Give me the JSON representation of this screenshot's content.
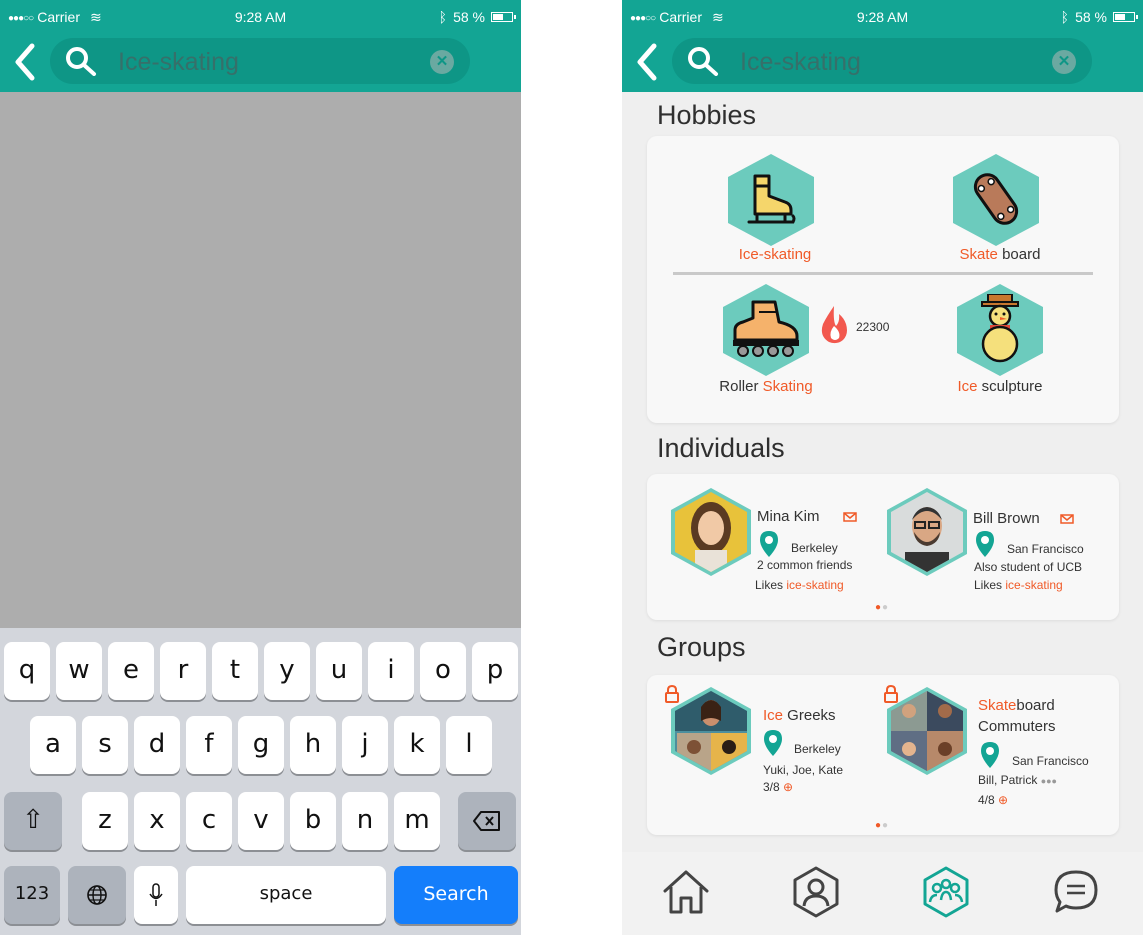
{
  "status": {
    "carrier": "Carrier",
    "time": "9:28 AM",
    "battery": "58 %"
  },
  "search": {
    "query": "Ice-skating"
  },
  "keyboard": {
    "row1": [
      "q",
      "w",
      "e",
      "r",
      "t",
      "y",
      "u",
      "i",
      "o",
      "p"
    ],
    "row2": [
      "a",
      "s",
      "d",
      "f",
      "g",
      "h",
      "j",
      "k",
      "l"
    ],
    "row3": [
      "z",
      "x",
      "c",
      "v",
      "b",
      "n",
      "m"
    ],
    "numbers_label": "123",
    "space_label": "space",
    "search_label": "Search"
  },
  "results": {
    "hobbies_title": "Hobbies",
    "hobbies": [
      {
        "match": "Ice-skating",
        "rest": ""
      },
      {
        "match": "Skate",
        "rest": " board"
      },
      {
        "prefix": "Roller ",
        "match": "Skating"
      },
      {
        "match": "Ice",
        "rest": " sculpture"
      }
    ],
    "trending_count": "22300",
    "individuals_title": "Individuals",
    "individuals": [
      {
        "name": "Mina Kim",
        "location": "Berkeley",
        "detail": "2 common friends",
        "likes_prefix": "Likes ",
        "likes": "ice-skating"
      },
      {
        "name": "Bill Brown",
        "location": "San Francisco",
        "detail": "Also student of UCB",
        "likes_prefix": "Likes ",
        "likes": "ice-skating"
      }
    ],
    "groups_title": "Groups",
    "groups": [
      {
        "name_match": "Ice",
        "name_rest": " Greeks",
        "location": "Berkeley",
        "members": "Yuki, Joe, Kate",
        "capacity": "3/8"
      },
      {
        "name_match": "Skate",
        "name_rest": "board",
        "name_line2": "Commuters",
        "location": "San Francisco",
        "members": "Bill, Patrick",
        "capacity": "4/8"
      }
    ]
  },
  "colors": {
    "teal": "#13a594",
    "hex_fill": "#6ccbbd",
    "accent": "#f05a28",
    "keyboard_blue": "#147efb"
  },
  "icons": {
    "tabbar": [
      "home-icon",
      "profile-icon",
      "groups-icon",
      "chat-icon"
    ]
  }
}
